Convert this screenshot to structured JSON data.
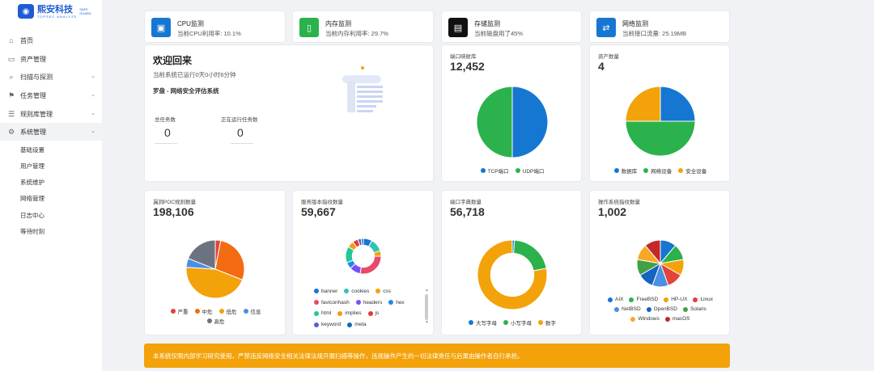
{
  "brand": {
    "name": "熙安科技",
    "en_top": "SAFE",
    "en_bottom": "GUARD",
    "tagline": "TOPSEC ANALYZE"
  },
  "sidebar": {
    "items": [
      {
        "label": "首页",
        "icon": "home-icon"
      },
      {
        "label": "资产管理",
        "icon": "box-icon"
      },
      {
        "label": "扫描与探测",
        "icon": "search-icon"
      },
      {
        "label": "任务管理",
        "icon": "task-icon"
      },
      {
        "label": "规则库管理",
        "icon": "database-icon"
      },
      {
        "label": "系统管理",
        "icon": "gear-icon"
      }
    ],
    "subitems": [
      "基础设置",
      "用户管理",
      "系统维护",
      "网络管理",
      "日志中心",
      "等待时刻"
    ]
  },
  "monitors": [
    {
      "title": "CPU监测",
      "value": "当前CPU利用率: 10.1%",
      "color": "#1677d2",
      "icon": "cpu-icon"
    },
    {
      "title": "内存监测",
      "value": "当前内存利用率: 29.7%",
      "color": "#2bb24c",
      "icon": "memory-icon"
    },
    {
      "title": "存储监测",
      "value": "当前磁盘用了45%",
      "color": "#111111",
      "icon": "storage-icon"
    },
    {
      "title": "网络监测",
      "value": "当前接口流量: 25.19MB",
      "color": "#1677d2",
      "icon": "network-icon"
    }
  ],
  "welcome": {
    "title": "欢迎回来",
    "runtime": "当前系统已运行0天0小时6分钟",
    "system": "罗盘 - 网络安全评估系统",
    "total_label": "总任务数",
    "total_value": "0",
    "running_label": "正在运行任务数",
    "running_value": "0"
  },
  "stats": {
    "port_map": {
      "label": "端口映射库",
      "value": "12,452"
    },
    "assets": {
      "label": "资产数量",
      "value": "4"
    },
    "poc": {
      "label": "漏洞POC规则数量",
      "value": "198,106"
    },
    "service": {
      "label": "服务版本指纹数量",
      "value": "59,667"
    },
    "dict": {
      "label": "端口字典数量",
      "value": "56,718"
    },
    "os": {
      "label": "操作系统指纹数量",
      "value": "1,002"
    }
  },
  "chart_data": [
    {
      "type": "pie",
      "title": "端口映射库",
      "series": [
        {
          "name": "TCP端口",
          "value": 50,
          "color": "#1677d2"
        },
        {
          "name": "UDP端口",
          "value": 50,
          "color": "#2bb24c"
        }
      ]
    },
    {
      "type": "pie",
      "title": "资产数量",
      "series": [
        {
          "name": "数据库",
          "value": 1,
          "color": "#1677d2"
        },
        {
          "name": "网络设备",
          "value": 2,
          "color": "#2bb24c"
        },
        {
          "name": "安全设备",
          "value": 1,
          "color": "#f3a20a"
        }
      ]
    },
    {
      "type": "pie",
      "title": "漏洞POC规则数量",
      "series": [
        {
          "name": "严重",
          "value": 3,
          "color": "#e0443b"
        },
        {
          "name": "中危",
          "value": 28,
          "color": "#f36b12"
        },
        {
          "name": "低危",
          "value": 45,
          "color": "#f3a20a"
        },
        {
          "name": "信息",
          "value": 5,
          "color": "#4a90e2"
        },
        {
          "name": "高危",
          "value": 19,
          "color": "#6b7280"
        }
      ]
    },
    {
      "type": "pie",
      "title": "服务版本指纹数量",
      "donut": true,
      "series": [
        {
          "name": "banner",
          "value": 8,
          "color": "#1677d2"
        },
        {
          "name": "cookies",
          "value": 12,
          "color": "#2ec4b6"
        },
        {
          "name": "css",
          "value": 5,
          "color": "#f3a20a"
        },
        {
          "name": "faviconhash",
          "value": 28,
          "color": "#e84b6a"
        },
        {
          "name": "headers",
          "value": 10,
          "color": "#7c4dff"
        },
        {
          "name": "hex",
          "value": 6,
          "color": "#1e88e5"
        },
        {
          "name": "html",
          "value": 15,
          "color": "#20c997"
        },
        {
          "name": "implies",
          "value": 6,
          "color": "#f39c12"
        },
        {
          "name": "js",
          "value": 5,
          "color": "#e53935"
        },
        {
          "name": "keyword",
          "value": 3,
          "color": "#5b5fc7"
        },
        {
          "name": "meta",
          "value": 2,
          "color": "#1565c0"
        }
      ]
    },
    {
      "type": "pie",
      "title": "端口字典数量",
      "donut": true,
      "series": [
        {
          "name": "大写字母",
          "value": 1,
          "color": "#1677d2"
        },
        {
          "name": "小写字母",
          "value": 21,
          "color": "#2bb24c"
        },
        {
          "name": "数字",
          "value": 78,
          "color": "#f3a20a"
        }
      ]
    },
    {
      "type": "pie",
      "title": "操作系统指纹数量",
      "series": [
        {
          "name": "AIX",
          "value": 10,
          "color": "#1677d2"
        },
        {
          "name": "FreeBSD",
          "value": 10,
          "color": "#2bb24c"
        },
        {
          "name": "HP-UX",
          "value": 10,
          "color": "#f3a20a"
        },
        {
          "name": "Linux",
          "value": 10,
          "color": "#e0443b"
        },
        {
          "name": "NetBSD",
          "value": 10,
          "color": "#4a90e2"
        },
        {
          "name": "OpenBSD",
          "value": 10,
          "color": "#1565c0"
        },
        {
          "name": "Solaris",
          "value": 10,
          "color": "#43a047"
        },
        {
          "name": "Windows",
          "value": 10,
          "color": "#f9a825"
        },
        {
          "name": "macOS",
          "value": 10,
          "color": "#c62828"
        }
      ]
    }
  ],
  "banner_text": "本系统仅限内部学习研究使用，严禁违反网络安全相关法律法规开展扫描等操作，违规操作产生的一切法律责任与后果由操作者自行承担。"
}
